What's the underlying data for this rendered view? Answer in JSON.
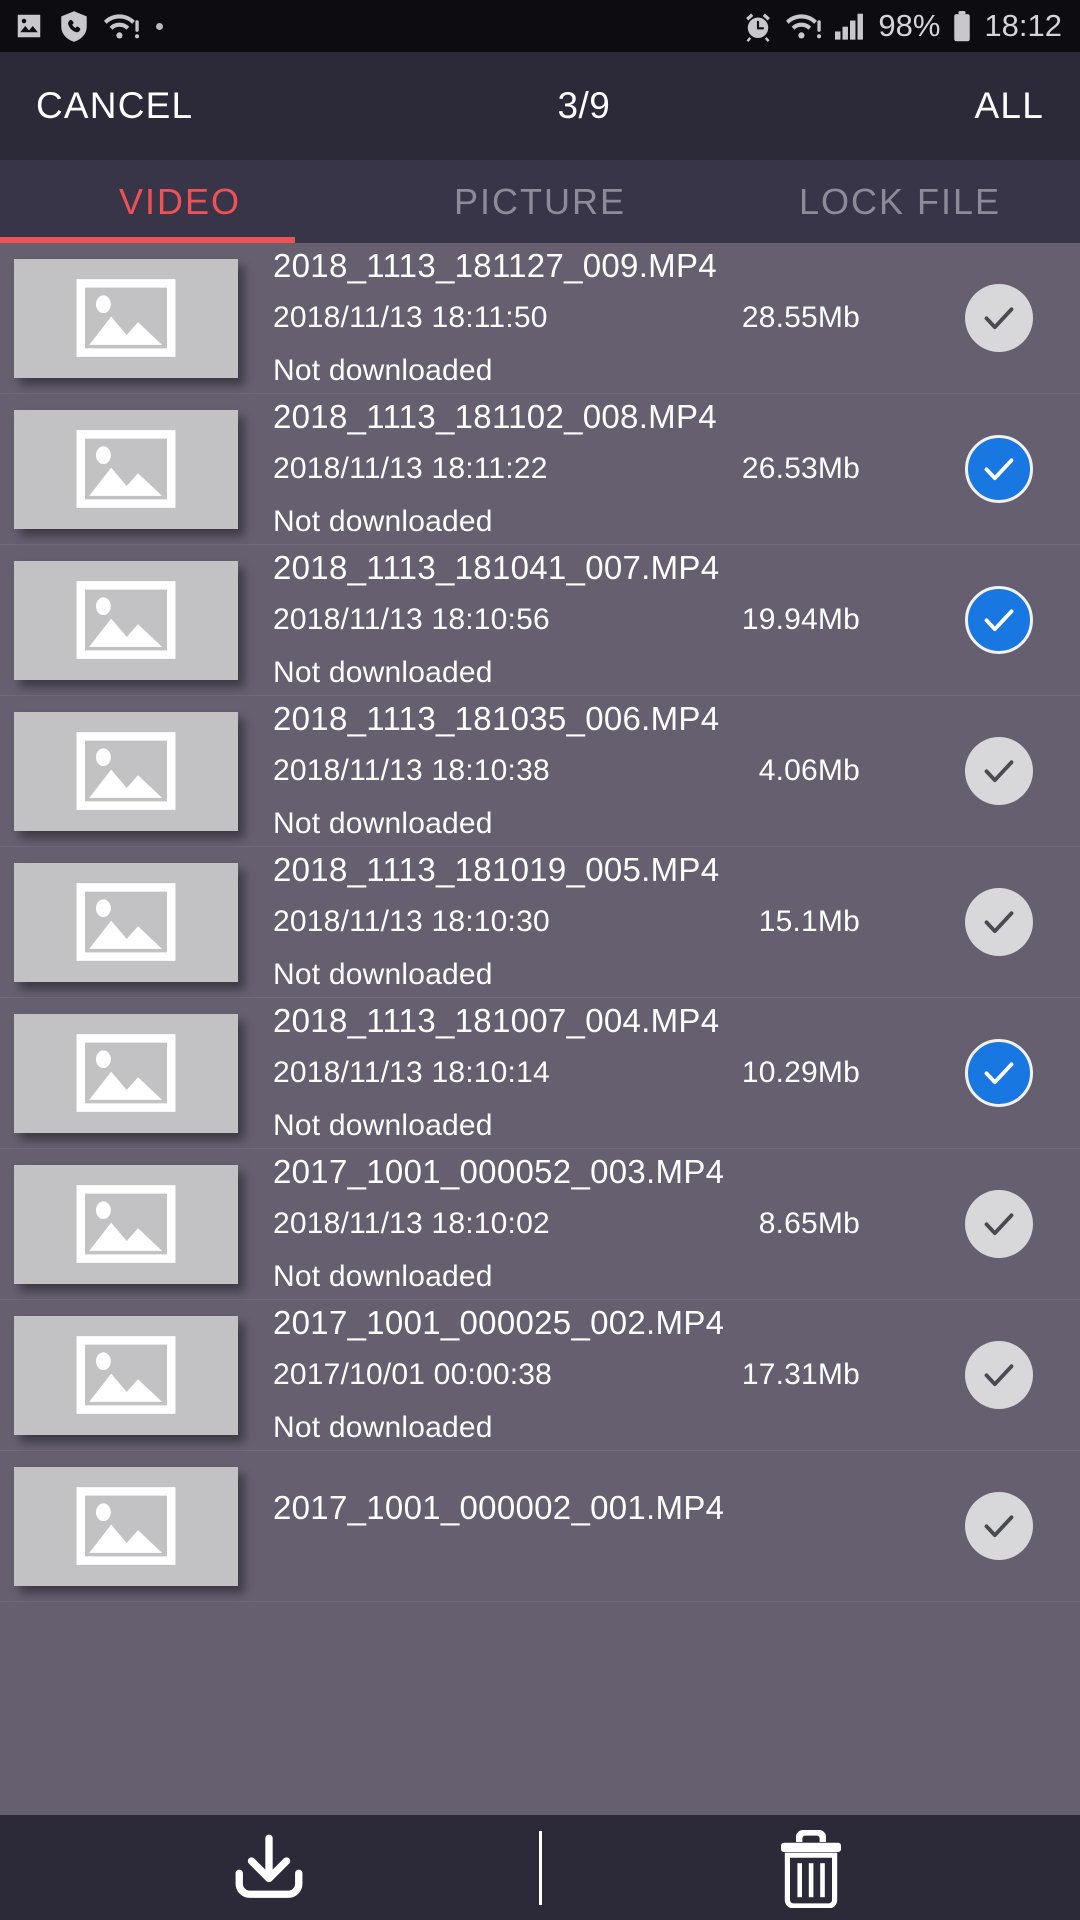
{
  "statusbar": {
    "left_icons": [
      "photo-icon",
      "phone-shield-icon",
      "wifi-alert-icon",
      "dot-indicator"
    ],
    "right_icons": [
      "alarm-icon",
      "wifi-alert-icon",
      "signal-bars-icon",
      "battery-icon"
    ],
    "battery": "98%",
    "clock": "18:12"
  },
  "header": {
    "cancel_label": "CANCEL",
    "title": "3/9",
    "all_label": "ALL"
  },
  "tabs": {
    "items": [
      {
        "label": "VIDEO",
        "active": true
      },
      {
        "label": "PICTURE",
        "active": false
      },
      {
        "label": "LOCK FILE",
        "active": false
      }
    ],
    "active_color": "#f05157",
    "inactive_color": "#8d8a99"
  },
  "list": {
    "rows": [
      {
        "name": "2018_1113_181127_009.MP4",
        "date": "2018/11/13 18:11:50",
        "size": "28.55Mb",
        "status": "Not downloaded",
        "selected": false
      },
      {
        "name": "2018_1113_181102_008.MP4",
        "date": "2018/11/13 18:11:22",
        "size": "26.53Mb",
        "status": "Not downloaded",
        "selected": true
      },
      {
        "name": "2018_1113_181041_007.MP4",
        "date": "2018/11/13 18:10:56",
        "size": "19.94Mb",
        "status": "Not downloaded",
        "selected": true
      },
      {
        "name": "2018_1113_181035_006.MP4",
        "date": "2018/11/13 18:10:38",
        "size": "4.06Mb",
        "status": "Not downloaded",
        "selected": false
      },
      {
        "name": "2018_1113_181019_005.MP4",
        "date": "2018/11/13 18:10:30",
        "size": "15.1Mb",
        "status": "Not downloaded",
        "selected": false
      },
      {
        "name": "2018_1113_181007_004.MP4",
        "date": "2018/11/13 18:10:14",
        "size": "10.29Mb",
        "status": "Not downloaded",
        "selected": true
      },
      {
        "name": "2017_1001_000052_003.MP4",
        "date": "2018/11/13 18:10:02",
        "size": "8.65Mb",
        "status": "Not downloaded",
        "selected": false
      },
      {
        "name": "2017_1001_000025_002.MP4",
        "date": "2017/10/01 00:00:38",
        "size": "17.31Mb",
        "status": "Not downloaded",
        "selected": false
      },
      {
        "name": "2017_1001_000002_001.MP4",
        "date": "",
        "size": "",
        "status": "",
        "selected": false
      }
    ],
    "selected_color": "#1877e0",
    "unselected_color": "#d8d8da"
  },
  "footer": {
    "download_icon": "download-icon",
    "delete_icon": "trash-icon"
  }
}
